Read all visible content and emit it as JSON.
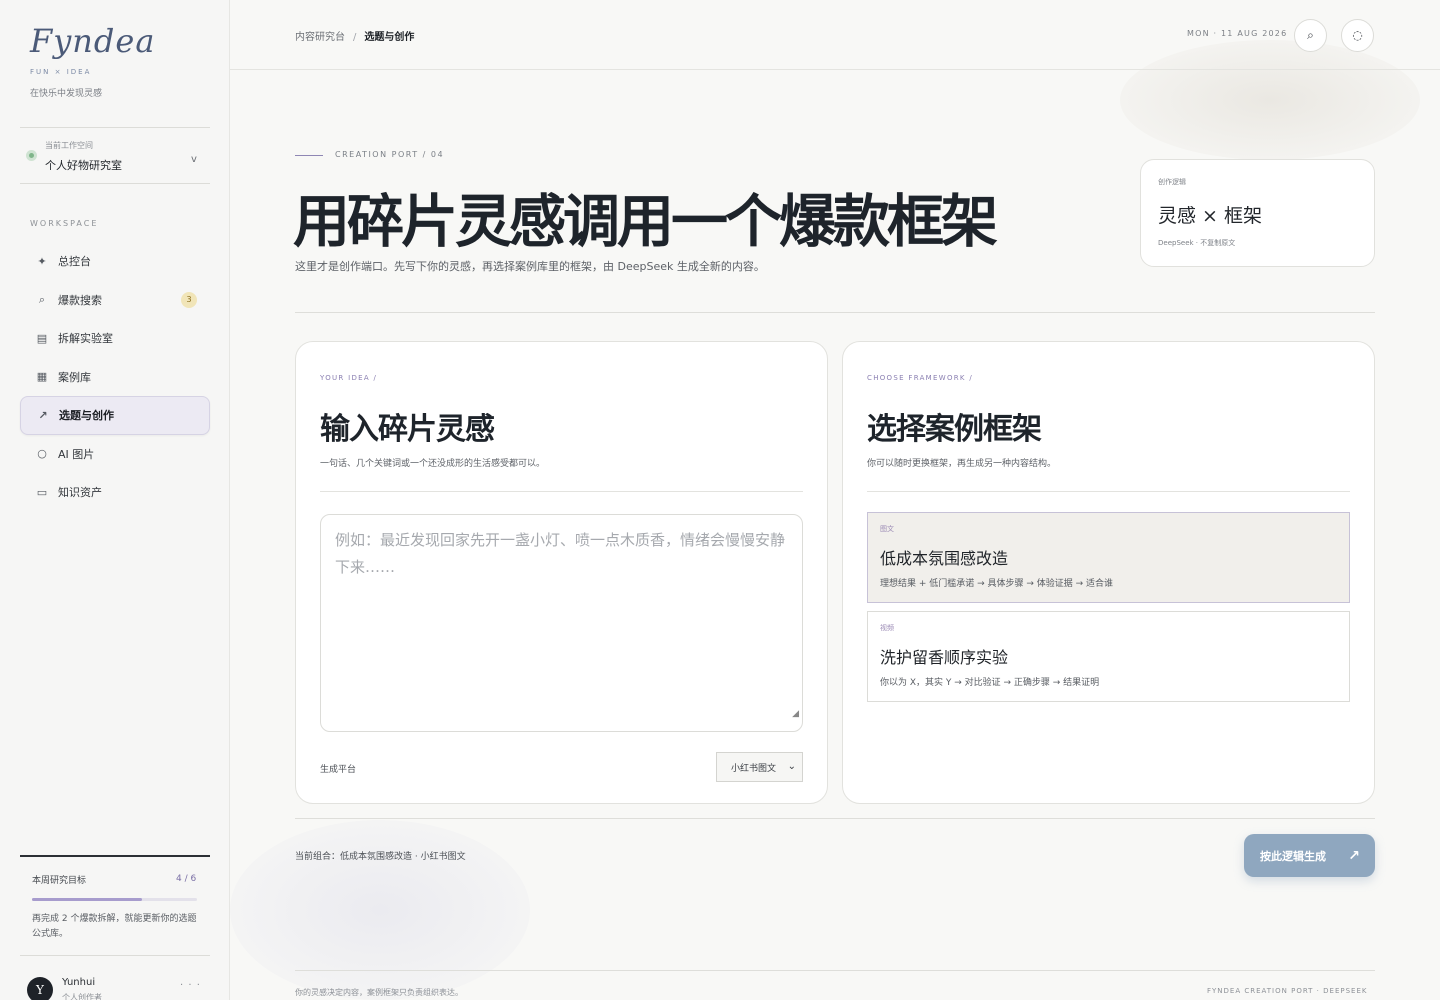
{
  "brand": {
    "logo": "Fyndea",
    "sub": "FUN × IDEA",
    "tagline": "在快乐中发现灵感"
  },
  "workspace": {
    "label": "当前工作空间",
    "name": "个人好物研究室",
    "caret": "v"
  },
  "sidebar": {
    "section": "WORKSPACE",
    "items": [
      {
        "label": "总控台",
        "icon": "✦"
      },
      {
        "label": "爆款搜索",
        "icon": "⌕",
        "badge": "3"
      },
      {
        "label": "拆解实验室",
        "icon": "▤"
      },
      {
        "label": "案例库",
        "icon": "▦"
      },
      {
        "label": "选题与创作",
        "icon": "↗"
      },
      {
        "label": "AI 图片",
        "icon": "○"
      },
      {
        "label": "知识资产",
        "icon": "▭"
      }
    ],
    "goal": {
      "title": "本周研究目标",
      "count": "4 / 6",
      "progress": 0.667,
      "desc": "再完成 2 个爆款拆解，就能更新你的选题公式库。"
    },
    "user": {
      "initial": "Y",
      "name": "Yunhui",
      "role": "个人创作者",
      "more": "· · ·"
    }
  },
  "topbar": {
    "breadcrumb": [
      "内容研究台",
      "选题与创作"
    ],
    "separator": "/",
    "date": "MON · 11 AUG 2026",
    "search_icon": "⌕",
    "status_icon": "◌"
  },
  "header": {
    "eyebrow": "CREATION PORT / 04",
    "title": "用碎片灵感调用一个爆款框架",
    "subtitle": "这里才是创作端口。先写下你的灵感，再选择案例库里的框架，由 DeepSeek 生成全新的内容。",
    "logic_card": {
      "kicker": "创作逻辑",
      "title": "灵感 × 框架",
      "meta": "DeepSeek · 不复制原文"
    }
  },
  "idea_card": {
    "kicker": "YOUR IDEA /",
    "title": "输入碎片灵感",
    "desc": "一句话、几个关键词或一个还没成形的生活感受都可以。",
    "placeholder": "例如：最近发现回家先开一盏小灯、喷一点木质香，情绪会慢慢安静下来……",
    "platform_label": "生成平台",
    "platform_value": "小红书图文"
  },
  "framework_card": {
    "kicker": "CHOOSE FRAMEWORK /",
    "title": "选择案例框架",
    "desc": "你可以随时更换框架，再生成另一种内容结构。",
    "items": [
      {
        "tag": "图文",
        "title": "低成本氛围感改造",
        "flow": "理想结果 + 低门槛承诺 → 具体步骤 → 体验证据 → 适合谁"
      },
      {
        "tag": "视频",
        "title": "洗护留香顺序实验",
        "flow": "你以为 X，其实 Y → 对比验证 → 正确步骤 → 结果证明"
      }
    ]
  },
  "footer": {
    "combo": "当前组合：低成本氛围感改造 · 小红书图文",
    "generate": "按此逻辑生成",
    "generate_arrow": "↗",
    "note_left": "你的灵感决定内容，案例框架只负责组织表达。",
    "note_right": "FYNDEA CREATION PORT · DEEPSEEK"
  },
  "colors": {
    "accent": "#8f87b4",
    "button": "#8fa7bf",
    "badge": "#f1e5b8"
  }
}
